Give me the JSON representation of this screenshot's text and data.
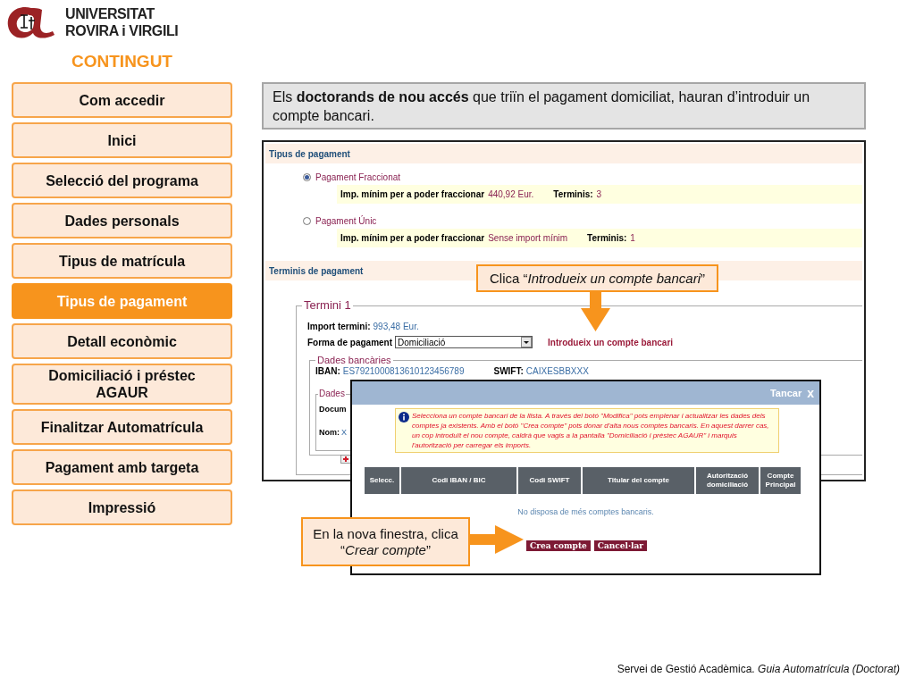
{
  "logo": {
    "lines": [
      "UNIVERSITAT",
      "ROVIRA i VIRGILI"
    ]
  },
  "sidebar": {
    "title": "CONTINGUT",
    "items": [
      {
        "label": "Com accedir",
        "selected": false
      },
      {
        "label": "Inici",
        "selected": false
      },
      {
        "label": "Selecció del programa",
        "selected": false
      },
      {
        "label": "Dades personals",
        "selected": false
      },
      {
        "label": "Tipus de matrícula",
        "selected": false
      },
      {
        "label": "Tipus de pagament",
        "selected": true
      },
      {
        "label": "Detall econòmic",
        "selected": false
      },
      {
        "label": "Domiciliació i préstec AGAUR",
        "selected": false
      },
      {
        "label": "Finalitzar Automatrícula",
        "selected": false
      },
      {
        "label": "Pagament amb targeta",
        "selected": false
      },
      {
        "label": "Impressió",
        "selected": false
      }
    ]
  },
  "note": "Els **doctorands de nou accés** que triïn el pagament domiciliat, hauran d’introduir un compte bancari.",
  "screenshot": {
    "payment_type": {
      "title": "Tipus de pagament",
      "options": [
        {
          "label": "Pagament Fraccionat",
          "selected": true,
          "min_label": "Imp. mínim per a poder fraccionar",
          "min_value": "440,92 Eur.",
          "terms_label": "Terminis:",
          "terms_value": "3"
        },
        {
          "label": "Pagament Únic",
          "selected": false,
          "min_label": "Imp. mínim per a poder fraccionar",
          "min_value": "Sense import mínim",
          "terms_label": "Terminis:",
          "terms_value": "1"
        }
      ]
    },
    "terms": {
      "title": "Terminis de pagament",
      "legend": "Termini 1",
      "amount_label": "Import termini:",
      "amount_value": "993,48 Eur.",
      "method_label": "Forma de pagament",
      "method_value": "Domiciliació",
      "link": "Introdueix un compte bancari",
      "bank": {
        "legend": "Dades bancàries",
        "iban_label": "IBAN:",
        "iban_value": "ES7921000813610123456789",
        "swift_label": "SWIFT:",
        "swift_value": "CAIXESBBXXX",
        "inner_legend": "Dades",
        "doc_label": "Docum",
        "name_label": "Nom:",
        "name_value": "X"
      }
    }
  },
  "dialog": {
    "close": "Tancar",
    "close_icon": "x",
    "info": "Selecciona un compte bancari de la llista. A través del botó \"Modifica\" pots emplenar i actualitzar les dades dels comptes ja existents. Amb el botó \"Crea compte\" pots donar d'alta nous comptes bancaris. En aquest darrer cas, un cop introduït el nou compte, caldrà que vagis a la pantalla \"Domiciliació i préstec AGAUR\" i marquis l'autorització per carregar els imports.",
    "columns": [
      "Selecc.",
      "Codi IBAN / BIC",
      "Codi SWIFT",
      "Titular del compte",
      "Autorització domiciliació",
      "Compte Principal"
    ],
    "empty": "No disposa de més comptes bancaris.",
    "buttons": [
      "Crea compte",
      "Cancel·lar"
    ]
  },
  "callouts": [
    "Clica “*Introdueix un compte bancari*”",
    "En la nova finestra, clica “*Crear compte*”"
  ],
  "footer": "Servei de Gestió Acadèmica. *Guia Automatrícula (Doctorat)*"
}
